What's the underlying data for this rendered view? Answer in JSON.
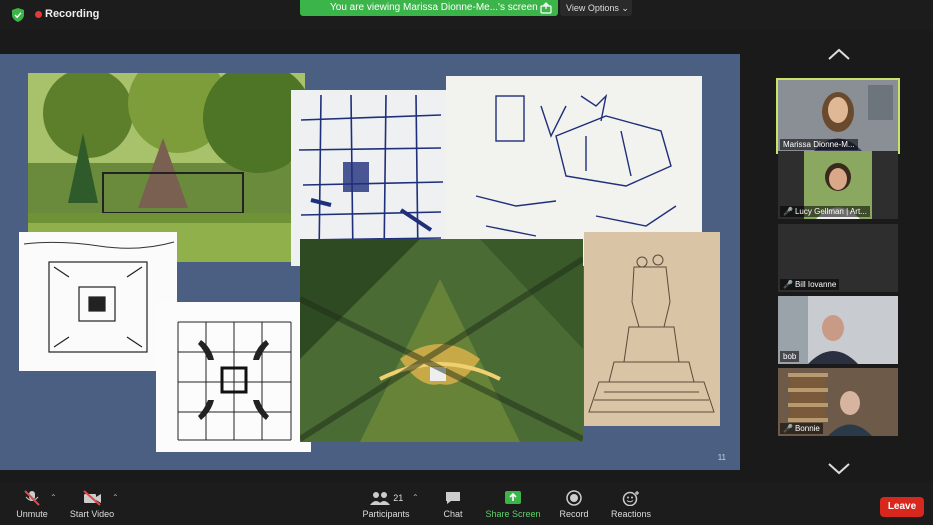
{
  "top_bar": {
    "recording_label": "Recording",
    "banner_text": "You are viewing Marissa Dionne-Me...'s screen",
    "view_options_label": "View Options"
  },
  "slide": {
    "page_number": "11",
    "images": [
      {
        "name": "park-monument-photo"
      },
      {
        "name": "grid-sketch-1"
      },
      {
        "name": "perspective-sketch"
      },
      {
        "name": "plan-sketch-small"
      },
      {
        "name": "plan-sketch-grid"
      },
      {
        "name": "aerial-site-photo"
      },
      {
        "name": "statue-sketch"
      }
    ]
  },
  "participants": [
    {
      "name": "Marissa Dionne-M...",
      "muted": false
    },
    {
      "name": "Lucy Gellman | Art...",
      "muted": true
    },
    {
      "name": "Bill Iovanne",
      "muted": true
    },
    {
      "name": "bob",
      "muted": false
    },
    {
      "name": "Bonnie",
      "muted": true
    }
  ],
  "toolbar": {
    "unmute_label": "Unmute",
    "start_video_label": "Start Video",
    "participants_label": "Participants",
    "participants_count": "21",
    "chat_label": "Chat",
    "share_screen_label": "Share Screen",
    "record_label": "Record",
    "reactions_label": "Reactions",
    "leave_label": "Leave"
  },
  "colors": {
    "banner": "#3bb54a",
    "slide_bg": "#4a5f82",
    "leave": "#d8281d",
    "active_speaker": "#c9e26a",
    "share_screen": "#3bb54a"
  }
}
